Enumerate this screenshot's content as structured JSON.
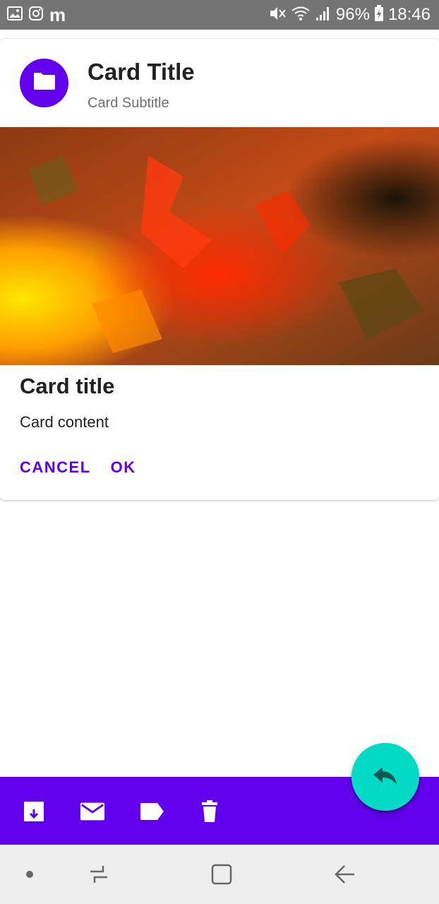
{
  "status_bar": {
    "left_icons": [
      "gallery-icon",
      "instagram-icon"
    ],
    "app_letter": "m",
    "battery_percent": "96%",
    "time": "18:46",
    "right_icons": [
      "mute-icon",
      "wifi-icon",
      "signal-icon",
      "battery-charging-icon"
    ]
  },
  "card": {
    "header": {
      "avatar_icon": "folder-icon",
      "title": "Card Title",
      "subtitle": "Card Subtitle"
    },
    "media": {
      "description_icon": "image"
    },
    "body": {
      "title": "Card title",
      "content": "Card content"
    },
    "actions": {
      "cancel_label": "CANCEL",
      "ok_label": "OK"
    }
  },
  "bottom_app_bar": {
    "background": "#6200ee",
    "items": [
      {
        "icon": "archive-icon"
      },
      {
        "icon": "mail-icon"
      },
      {
        "icon": "label-icon"
      },
      {
        "icon": "delete-icon"
      }
    ]
  },
  "fab": {
    "icon": "reply-icon",
    "color": "#03dac5"
  },
  "nav_bar": {
    "items": [
      "dot-icon",
      "recents-icon",
      "home-icon",
      "back-icon"
    ]
  },
  "colors": {
    "primary": "#6200ee",
    "secondary": "#03dac5",
    "status_bar": "#747474"
  }
}
